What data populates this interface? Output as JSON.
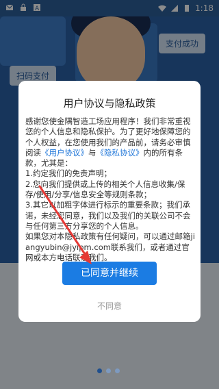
{
  "status_bar": {
    "time": "1:18"
  },
  "background": {
    "scan_label": "扫码支付",
    "pay_success_label": "支付成功"
  },
  "dialog": {
    "title": "用户协议与隐私政策",
    "body_intro": "感谢您使金隅智造工场应用程序！我们非常重视您的个人信息和隐私保护。为了更好地保障您的个人权益，在您使用我们的产品前，请务必审慎阅读",
    "link_user_agreement": "《用户协议》",
    "body_and": "与",
    "link_privacy_policy": "《隐私协议》",
    "body_after_links": "内的所有条款，尤其是：",
    "item1": "1.约定我们的免责声明；",
    "item2": "2.您向我们提供或上传的相关个人信息收集/保存/使用/分享/信息安全等规则条款；",
    "item3": "3.其它以加粗字体进行标示的重要条款；我们承诺，未经您同意，我们以及我们的关联公司不会与任何第三方分享您的个人信息。",
    "contact": "如果您对本隐私政策有任何疑问，可以通过邮箱jiangyubin@jyipm.com联系我们，或者通过官网或本方电话联系我们。",
    "agree_button": "已同意并继续",
    "disagree_button": "不同意"
  },
  "page_indicator": {
    "count": 3,
    "active_index": 0
  },
  "colors": {
    "primary": "#1b7ce3",
    "link": "#1a73d8",
    "annotation_arrow": "#e53935"
  }
}
